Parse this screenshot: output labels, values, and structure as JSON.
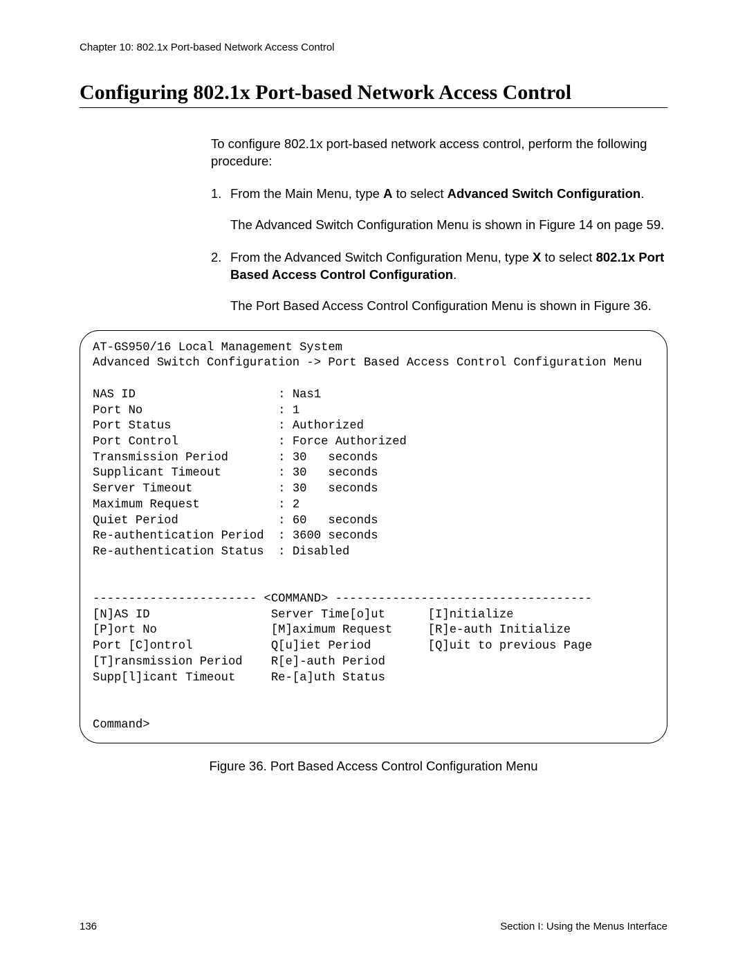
{
  "header": {
    "chapter": "Chapter 10: 802.1x Port-based Network Access Control"
  },
  "heading": "Configuring 802.1x Port-based Network Access Control",
  "intro": "To configure 802.1x port-based network access control, perform the following procedure:",
  "steps": {
    "s1": {
      "num": "1.",
      "pre": "From the Main Menu, type ",
      "key": "A",
      "mid": " to select ",
      "bold": "Advanced Switch Configuration",
      "post": ".",
      "follow": "The Advanced Switch Configuration Menu is shown in Figure 14 on page 59."
    },
    "s2": {
      "num": "2.",
      "pre": "From the Advanced Switch Configuration Menu, type ",
      "key": "X",
      "mid": " to select ",
      "bold": "802.1x Port Based Access Control Configuration",
      "post": ".",
      "follow": "The Port Based Access Control Configuration Menu is shown in Figure 36."
    }
  },
  "terminal": {
    "title": "AT-GS950/16 Local Management System",
    "breadcrumb": "Advanced Switch Configuration -> Port Based Access Control Configuration Menu",
    "fields": {
      "nas_id": {
        "label": "NAS ID",
        "value": "Nas1"
      },
      "port_no": {
        "label": "Port No",
        "value": "1"
      },
      "port_status": {
        "label": "Port Status",
        "value": "Authorized"
      },
      "port_control": {
        "label": "Port Control",
        "value": "Force Authorized"
      },
      "trans_period": {
        "label": "Transmission Period",
        "value": "30   seconds"
      },
      "supp_timeout": {
        "label": "Supplicant Timeout",
        "value": "30   seconds"
      },
      "server_timeout": {
        "label": "Server Timeout",
        "value": "30   seconds"
      },
      "max_request": {
        "label": "Maximum Request",
        "value": "2"
      },
      "quiet_period": {
        "label": "Quiet Period",
        "value": "60   seconds"
      },
      "reauth_period": {
        "label": "Re-authentication Period",
        "value": "3600 seconds"
      },
      "reauth_status": {
        "label": "Re-authentication Status",
        "value": "Disabled"
      }
    },
    "cmd_divider": "----------------------- <COMMAND> ------------------------------------",
    "commands": {
      "c1a": "[N]AS ID",
      "c1b": "Server Time[o]ut",
      "c1c": "[I]nitialize",
      "c2a": "[P]ort No",
      "c2b": "[M]aximum Request",
      "c2c": "[R]e-auth Initialize",
      "c3a": "Port [C]ontrol",
      "c3b": "Q[u]iet Period",
      "c3c": "[Q]uit to previous Page",
      "c4a": "[T]ransmission Period",
      "c4b": "R[e]-auth Period",
      "c5a": "Supp[l]icant Timeout",
      "c5b": "Re-[a]uth Status"
    },
    "prompt": "Command>"
  },
  "figure_caption": "Figure 36. Port Based Access Control Configuration Menu",
  "footer": {
    "page": "136",
    "section": "Section I: Using the Menus Interface"
  }
}
